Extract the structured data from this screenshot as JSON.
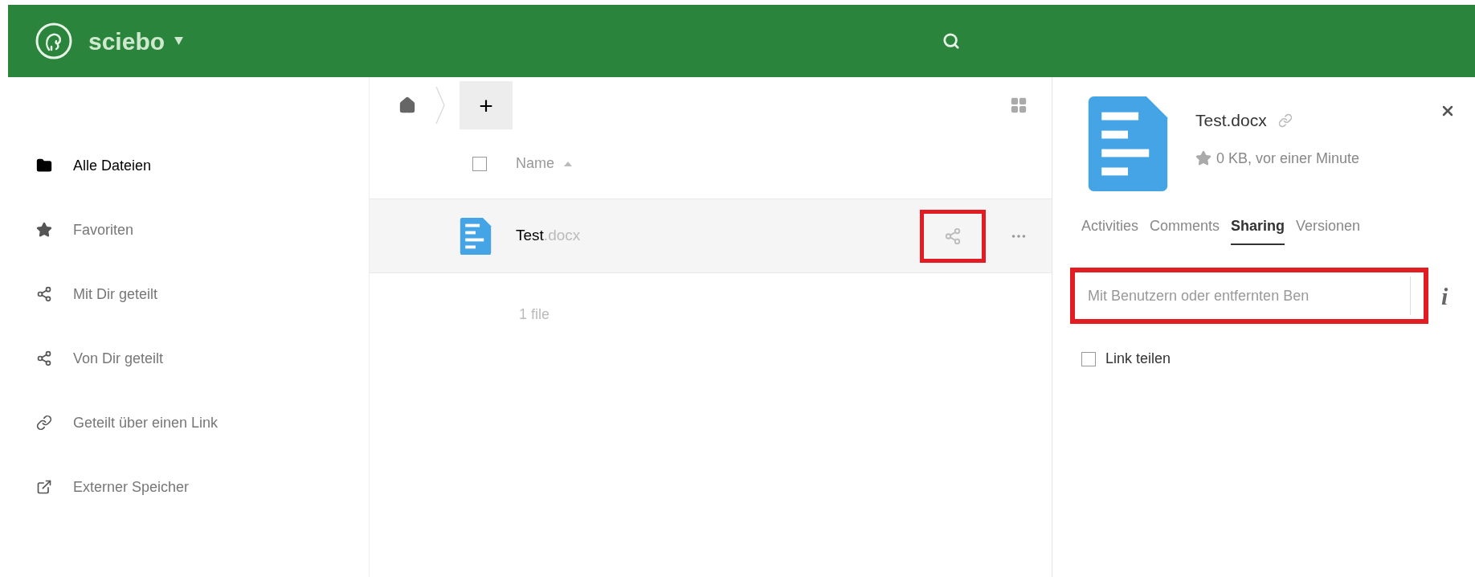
{
  "header": {
    "brand": "sciebo"
  },
  "sidebar": {
    "items": [
      {
        "label": "Alle Dateien",
        "kind": "folder",
        "selected": true
      },
      {
        "label": "Favoriten",
        "kind": "star",
        "selected": false
      },
      {
        "label": "Mit Dir geteilt",
        "kind": "share",
        "selected": false
      },
      {
        "label": "Von Dir geteilt",
        "kind": "share",
        "selected": false
      },
      {
        "label": "Geteilt über einen Link",
        "kind": "link",
        "selected": false
      },
      {
        "label": "Externer Speicher",
        "kind": "external",
        "selected": false
      }
    ]
  },
  "toolbar": {
    "new_button": "+"
  },
  "file_list": {
    "column": "Name",
    "select_all": {
      "checked": false
    },
    "rows": [
      {
        "name": "Test",
        "extension": ".docx",
        "share_highlighted": true
      }
    ],
    "summary": "1 file"
  },
  "details": {
    "title": "Test.docx",
    "meta": "0 KB, vor einer Minute",
    "tabs": [
      {
        "label": "Activities",
        "selected": false
      },
      {
        "label": "Comments",
        "selected": false
      },
      {
        "label": "Sharing",
        "selected": true
      },
      {
        "label": "Versionen",
        "selected": false
      }
    ],
    "share_field": {
      "placeholder": "Mit Benutzern oder entfernten Ben",
      "highlighted": true
    },
    "info": "i",
    "link_share": {
      "label": "Link teilen",
      "checked": false
    }
  }
}
